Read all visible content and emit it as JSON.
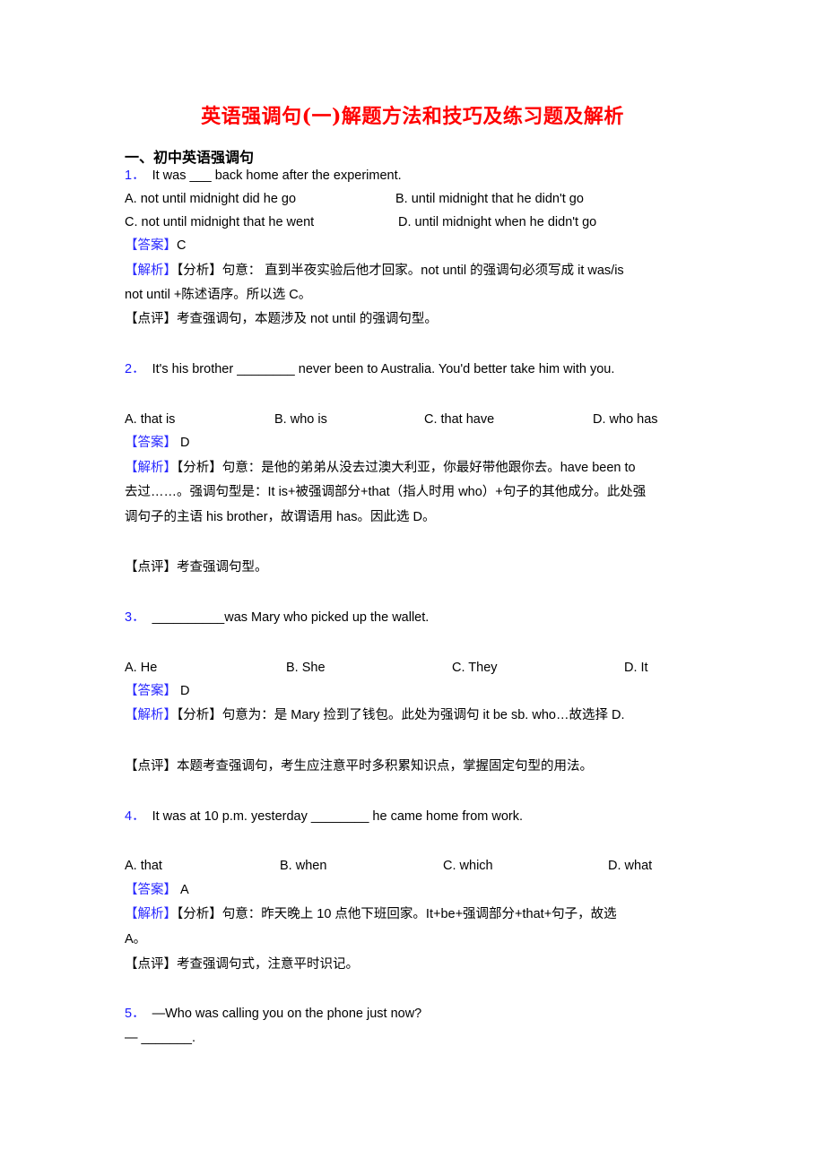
{
  "document": {
    "title": "英语强调句(一)解题方法和技巧及练习题及解析",
    "section_heading": "一、初中英语强调句",
    "labels": {
      "answer": "【答案】",
      "analysis": "【解析】",
      "comment": "【点评】"
    },
    "questions": [
      {
        "number": "1．",
        "stem": "It was ___ back home after the experiment.",
        "options": [
          "A. not until midnight did he go",
          "B. until midnight that he didn't go",
          "C. not until midnight that he went",
          "D. until midnight when he didn't go"
        ],
        "answer": "C",
        "analysis_lines": [
          "【分析】句意： 直到半夜实验后他才回家。not until 的强调句必须写成 it was/is",
          "not until +陈述语序。所以选 C。"
        ],
        "comment": "考查强调句，本题涉及 not until 的强调句型。"
      },
      {
        "number": "2．",
        "stem": "It's his brother ________ never been to Australia. You'd better take him with you.",
        "options": [
          "A. that is",
          "B. who is",
          "C. that have",
          "D. who has"
        ],
        "answer": " D",
        "analysis_lines": [
          "【分析】句意：是他的弟弟从没去过澳大利亚，你最好带他跟你去。have been to",
          "去过……。强调句型是：It is+被强调部分+that（指人时用 who）+句子的其他成分。此处强",
          "调句子的主语 his brother，故谓语用 has。因此选 D。"
        ],
        "comment": "考查强调句型。"
      },
      {
        "number": "3．",
        "stem": "__________was Mary who picked up the wallet.",
        "options": [
          "A. He",
          "B. She",
          "C. They",
          "D. It"
        ],
        "answer": " D",
        "analysis_lines": [
          "【分析】句意为：是 Mary 捡到了钱包。此处为强调句 it be sb. who…故选择 D."
        ],
        "comment": "本题考查强调句，考生应注意平时多积累知识点，掌握固定句型的用法。"
      },
      {
        "number": "4．",
        "stem": "It was at 10 p.m. yesterday ________ he came home from work.",
        "options": [
          "A. that",
          "B. when",
          "C. which",
          "D. what"
        ],
        "answer": " A",
        "analysis_lines": [
          "【分析】句意：昨天晚上 10 点他下班回家。It+be+强调部分+that+句子，故选",
          "A。"
        ],
        "comment": "考查强调句式，注意平时识记。"
      },
      {
        "number": "5．",
        "stem": "—Who was calling you on the phone just now?",
        "reply": "— _______."
      }
    ]
  }
}
